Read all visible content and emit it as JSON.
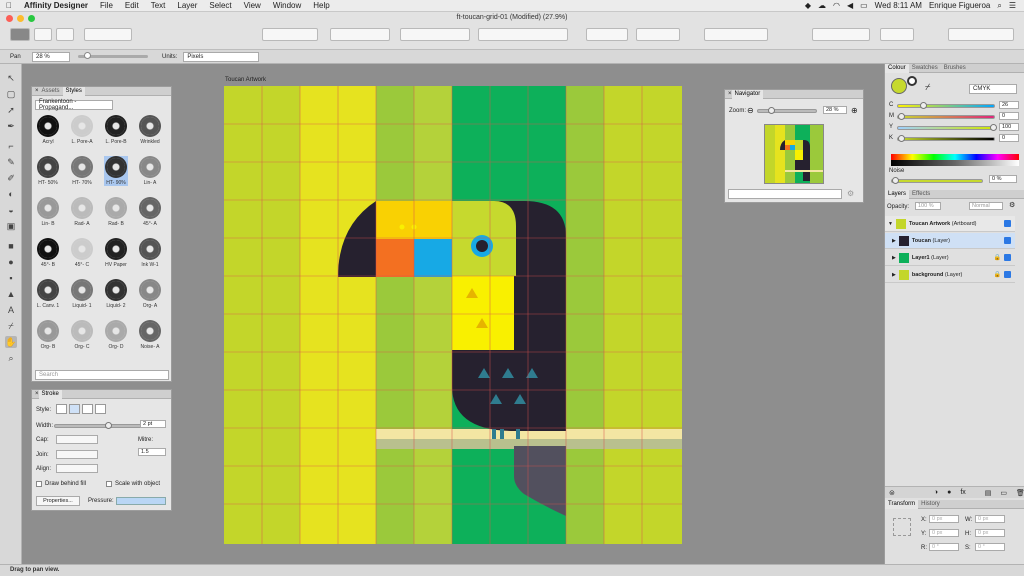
{
  "menubar": {
    "app": "Affinity Designer",
    "items": [
      "File",
      "Edit",
      "Text",
      "Layer",
      "Select",
      "View",
      "Window",
      "Help"
    ],
    "clock": "Wed 8:11 AM",
    "user": "Enrique Figueroa"
  },
  "window": {
    "title": "ft-toucan-grid-01 (Modified) (27.9%)"
  },
  "context": {
    "tool_label": "Pan",
    "zoom_value": "28 %",
    "units_label": "Units:",
    "units_value": "Pixels"
  },
  "artboard": {
    "label": "Toucan Artwork"
  },
  "styles_panel": {
    "tabs": [
      "Assets",
      "Styles"
    ],
    "category": "Frankentoon - Propagand...",
    "search_placeholder": "Search",
    "items": [
      "Acryl",
      "L. Pore-A",
      "L. Pore-B",
      "Wrinkled",
      "HT- 50%",
      "HT- 70%",
      "HT- 90%",
      "Lin- A",
      "Lin- B",
      "Rad- A",
      "Rad- B",
      "45°- A",
      "45°- B",
      "45°- C",
      "HV Paper",
      "Ink W-1",
      "L. Canv. 1",
      "Liquid- 1",
      "Liquid- 2",
      "Org- A",
      "Org- B",
      "Org- C",
      "Org- D",
      "Noise- A"
    ],
    "selected_index": 6
  },
  "stroke_panel": {
    "title": "Stroke",
    "style_label": "Style:",
    "width_label": "Width:",
    "width_value": "2 pt",
    "cap_label": "Cap:",
    "join_label": "Join:",
    "align_label": "Align:",
    "mitre_label": "Mitre:",
    "mitre_value": "1.5",
    "draw_behind": "Draw behind fill",
    "scale_with_object": "Scale with object",
    "properties_button": "Properties...",
    "pressure_label": "Pressure:"
  },
  "navigator": {
    "title": "Navigator",
    "zoom_label": "Zoom:",
    "zoom_value": "28 %"
  },
  "colour_panel": {
    "tabs": [
      "Colour",
      "Swatches",
      "Brushes"
    ],
    "model": "CMYK",
    "channels": [
      {
        "name": "C",
        "value": "26"
      },
      {
        "name": "M",
        "value": "0"
      },
      {
        "name": "Y",
        "value": "100"
      },
      {
        "name": "K",
        "value": "0"
      }
    ],
    "noise_label": "Noise",
    "noise_value": "0 %"
  },
  "layers_panel": {
    "tabs": [
      "Layers",
      "Effects"
    ],
    "opacity_label": "Opacity:",
    "opacity_value": "100 %",
    "blend_value": "Normal",
    "layers": [
      {
        "name": "Toucan Artwork",
        "type": "(Artboard)"
      },
      {
        "name": "Toucan",
        "type": "(Layer)"
      },
      {
        "name": "Layer1",
        "type": "(Layer)"
      },
      {
        "name": "background",
        "type": "(Layer)"
      }
    ]
  },
  "transform_panel": {
    "tabs": [
      "Transform",
      "History"
    ],
    "x_label": "X:",
    "x_value": "0 px",
    "y_label": "Y:",
    "y_value": "0 px",
    "w_label": "W:",
    "w_value": "0 px",
    "h_label": "H:",
    "h_value": "0 px",
    "r_label": "R:",
    "r_value": "0 °",
    "s_label": "S:",
    "s_value": "0 °"
  },
  "status": {
    "text": "Drag to pan view."
  },
  "colors": {
    "lime": "#c3d62a",
    "yellow": "#e6e31f",
    "green": "#9bc93b",
    "emerald": "#0db05a",
    "dark": "#26212f",
    "orange": "#f37021",
    "cyan": "#17a9e5",
    "beak": "#f9d103",
    "grid": "#d9534f"
  }
}
